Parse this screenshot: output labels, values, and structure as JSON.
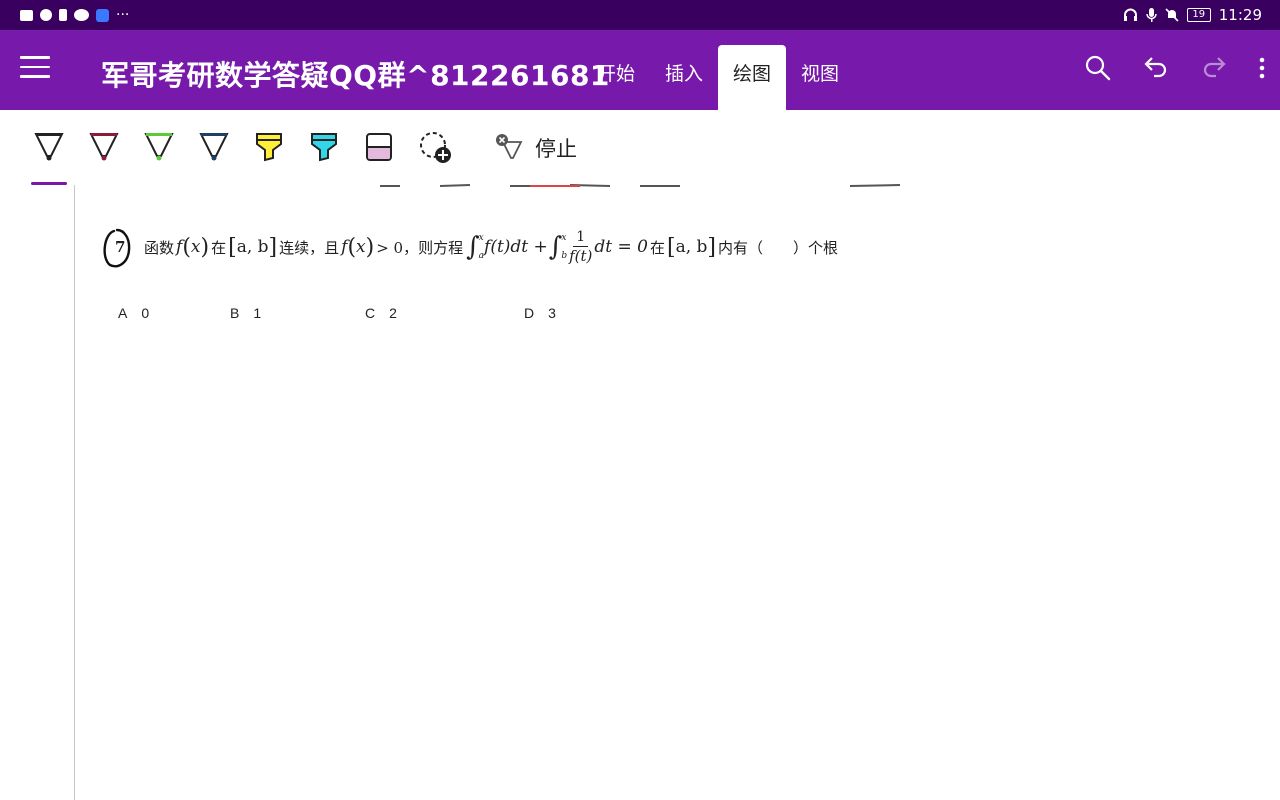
{
  "status_bar": {
    "time": "11:29",
    "battery": "19",
    "left_icons": [
      "video-icon",
      "user-icon",
      "notification-icon",
      "wechat-icon",
      "lamp-icon",
      "more-icon"
    ],
    "more_text": "···",
    "right_icons": [
      "headphones-icon",
      "mic-icon",
      "mute-icon",
      "battery-icon"
    ]
  },
  "app_bar": {
    "notebook_title": "军哥考研数学答疑QQ群^812261681",
    "tabs": [
      {
        "label": "开始",
        "active": false
      },
      {
        "label": "插入",
        "active": false
      },
      {
        "label": "绘图",
        "active": true
      },
      {
        "label": "视图",
        "active": false
      }
    ],
    "actions": [
      "search-icon",
      "undo-icon",
      "redo-icon",
      "more-vert-icon"
    ]
  },
  "draw_toolbar": {
    "pens": [
      {
        "name": "pen-black",
        "color": "#222222"
      },
      {
        "name": "pen-maroon",
        "color": "#8a1c3a"
      },
      {
        "name": "pen-green",
        "color": "#5cc93a"
      },
      {
        "name": "pen-navy",
        "color": "#1e3f66"
      },
      {
        "name": "highlighter-yellow",
        "color": "#ffef3a"
      },
      {
        "name": "highlighter-cyan",
        "color": "#31d6e8"
      },
      {
        "name": "eraser-pink",
        "color": "#e3b9dc"
      }
    ],
    "lasso": "lasso-add-icon",
    "stop_label": "停止"
  },
  "question": {
    "number": "7",
    "t1": "函数",
    "fx": "f",
    "x": "x",
    "t2": "在",
    "interval": "a, b",
    "t3": "连续，且",
    "t4": "> 0，则方程",
    "int1_lower": "a",
    "int1_upper": "x",
    "integrand1": "f(t)dt +",
    "int2_lower": "b",
    "int2_upper": "x",
    "frac_num": "1",
    "frac_den": "f(t)",
    "tail": "dt = 0",
    "t5": "在",
    "t6": "内有（　　）个根"
  },
  "options": [
    {
      "letter": "A",
      "value": "0"
    },
    {
      "letter": "B",
      "value": "1"
    },
    {
      "letter": "C",
      "value": "2"
    },
    {
      "letter": "D",
      "value": "3"
    }
  ],
  "colors": {
    "status_bar": "#3a0060",
    "app_bar": "#7719aa",
    "accent": "#7719aa"
  }
}
